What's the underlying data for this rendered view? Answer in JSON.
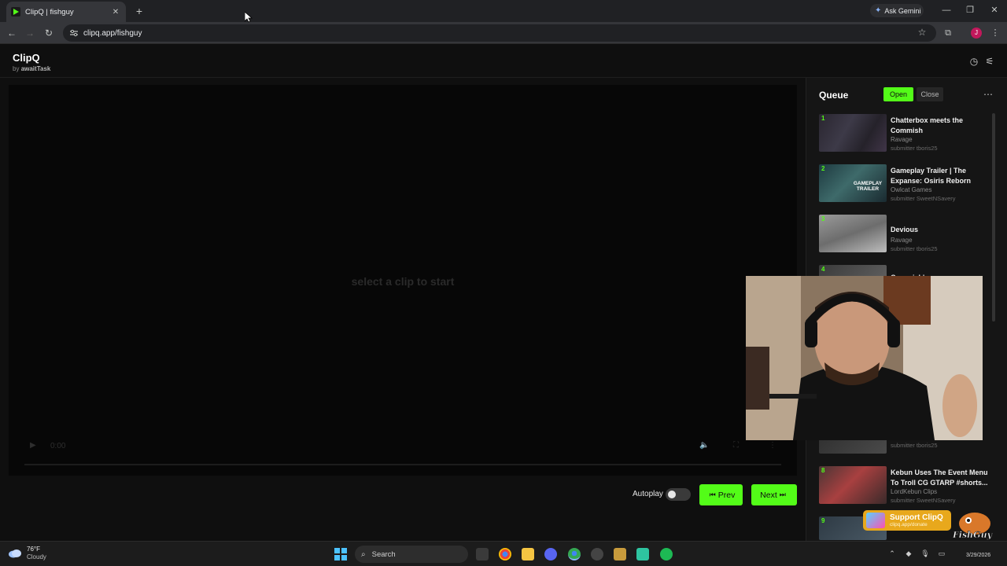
{
  "browser": {
    "tab_title": "ClipQ | fishguy",
    "tab_close": "✕",
    "new_tab": "+",
    "gemini_label": "Ask Gemini",
    "url": "clipq.app/fishguy",
    "profile_initial": "J"
  },
  "app": {
    "brand": "ClipQ",
    "byline_prefix": "by",
    "byline_author": "awaitTask"
  },
  "player": {
    "placeholder": "select a clip to start",
    "time": "0:00"
  },
  "controls": {
    "autoplay_label": "Autoplay",
    "autoplay_on": false,
    "prev_label": "Prev",
    "next_label": "Next"
  },
  "queue": {
    "title": "Queue",
    "open_label": "Open",
    "close_label": "Close",
    "items": [
      {
        "num": "1",
        "title": "Chatterbox meets the Commish",
        "channel": "Ravage",
        "submitter": "submitter tboris25"
      },
      {
        "num": "2",
        "title": "Gameplay Trailer | The Expanse: Osiris Reborn",
        "channel": "Owlcat Games",
        "submitter": "submitter SweetNSavery",
        "thumb_text": "GAMEPLAY TRAILER"
      },
      {
        "num": "3",
        "title": "Devious",
        "channel": "Ravage",
        "submitter": "submitter tboris25"
      },
      {
        "num": "4",
        "title": "Commish's war",
        "channel": "",
        "submitter": ""
      },
      {
        "num": "",
        "title": "",
        "channel": "",
        "submitter": "submitter tboris25"
      },
      {
        "num": "8",
        "title": "Kebun Uses The Event Menu To Troll CG GTARP #shorts...",
        "channel": "LordKebun Clips",
        "submitter": "submitter SweetNSavery"
      },
      {
        "num": "9",
        "title": "",
        "channel": "",
        "submitter": ""
      }
    ]
  },
  "overlay": {
    "support_label": "Support ClipQ",
    "support_url": "clipq.app/donate",
    "mascot_text": "FishGuy"
  },
  "taskbar": {
    "temperature": "76°F",
    "condition": "Cloudy",
    "search_label": "Search",
    "date": "3/29/2026"
  },
  "colors": {
    "accent_green": "#53fc18",
    "page_bg": "#0f0f0f",
    "support_orange": "#e8a81c"
  }
}
